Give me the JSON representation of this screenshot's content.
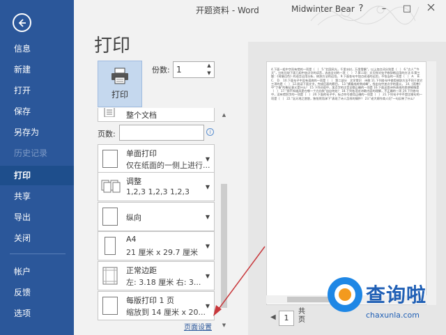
{
  "titlebar": {
    "title": "开题资料 - Word",
    "user": "Midwinter Bear",
    "help": "?",
    "minimize": "–",
    "restore": "□"
  },
  "nav": {
    "items": [
      {
        "label": "信息",
        "state": "normal"
      },
      {
        "label": "新建",
        "state": "normal"
      },
      {
        "label": "打开",
        "state": "normal"
      },
      {
        "label": "保存",
        "state": "normal"
      },
      {
        "label": "另存为",
        "state": "normal"
      },
      {
        "label": "历史记录",
        "state": "disabled"
      },
      {
        "label": "打印",
        "state": "active"
      },
      {
        "label": "共享",
        "state": "normal"
      },
      {
        "label": "导出",
        "state": "normal"
      },
      {
        "label": "关闭",
        "state": "normal"
      },
      {
        "label": "帐户",
        "state": "normal"
      },
      {
        "label": "反馈",
        "state": "normal"
      },
      {
        "label": "选项",
        "state": "normal"
      }
    ]
  },
  "print": {
    "heading": "打印",
    "print_button": "打印",
    "copies_label": "份数:",
    "copies_value": "1",
    "pages_label": "页数:",
    "pages_value": "",
    "info": "i",
    "page_setup": "页面设置",
    "options": {
      "range": "整个文档",
      "sides_l1": "单面打印",
      "sides_l2": "仅在纸面的一侧上进行...",
      "collate_l1": "调整",
      "collate_l2": "1,2,3    1,2,3    1,2,3",
      "orientation": "纵向",
      "size_l1": "A4",
      "size_l2": "21 厘米 x 29.7 厘米",
      "margins_l1": "正常边距",
      "margins_l2": "左: 3.18 厘米    右: 3...",
      "pps_l1": "每版打印 1 页",
      "pps_l2": "缩放到 14 厘米 x 20..."
    }
  },
  "preview": {
    "page_number": "1",
    "total_label": "共页",
    "doc_text": "4.下面一组中字形有错的一项是（　）  5.\"北国风光，千里冰封，万里雪飘\"，以上加点词分别是（　）  6.\"古人\"\"今天\"，分析比较下面几组中加点字的读音，选出全对的一项（　）  7.第二段：文天祥对句子修辞格运用的方法  8.第三题：《荷塘月色》的语言运用分析，修辞方法的运用。  9.下面各句中加点成语的运用，不恰当的一项是（　）  A.　B.　C.　D.　10.下面句子中没有语病的一项是（　）  第二部分　文学常识　诗歌  11.下列各句中使用修辞方法不同于其它三项的是（　）  12.阅读下面文字，完成后面的题目。  13.\"横看成岭侧成峰\"，找出句中加点字的意义。  14.《雨巷》中\"丁香\"的象征意义是什么？  15.下列词语中，加点字的注音全都正确的一项是  16.下面这首诗所表现的思想感情是（　）  17.\"我不知道风是在哪一个方向吹\"出自何处？  18.下列各项对诗歌内容的理解，不正确的一项  19.下列各句中，没有错别字的一项是（　）  20.下面的句子中，标点符号使用正确的一项是（　）  21.下列句子中不是比喻句的一项是（　）  22.\"念天地之悠悠，独怆然而涕下\"表现了诗人怎样的情怀？  23.\"老大嫁作商人妇\"一句反映了什么？"
  },
  "watermark": {
    "brand": "查询啦",
    "url": "chaxunla.com"
  },
  "colors": {
    "nav_bg": "#2b579a",
    "nav_active": "#1e4e8c",
    "accent": "#2b579a"
  }
}
